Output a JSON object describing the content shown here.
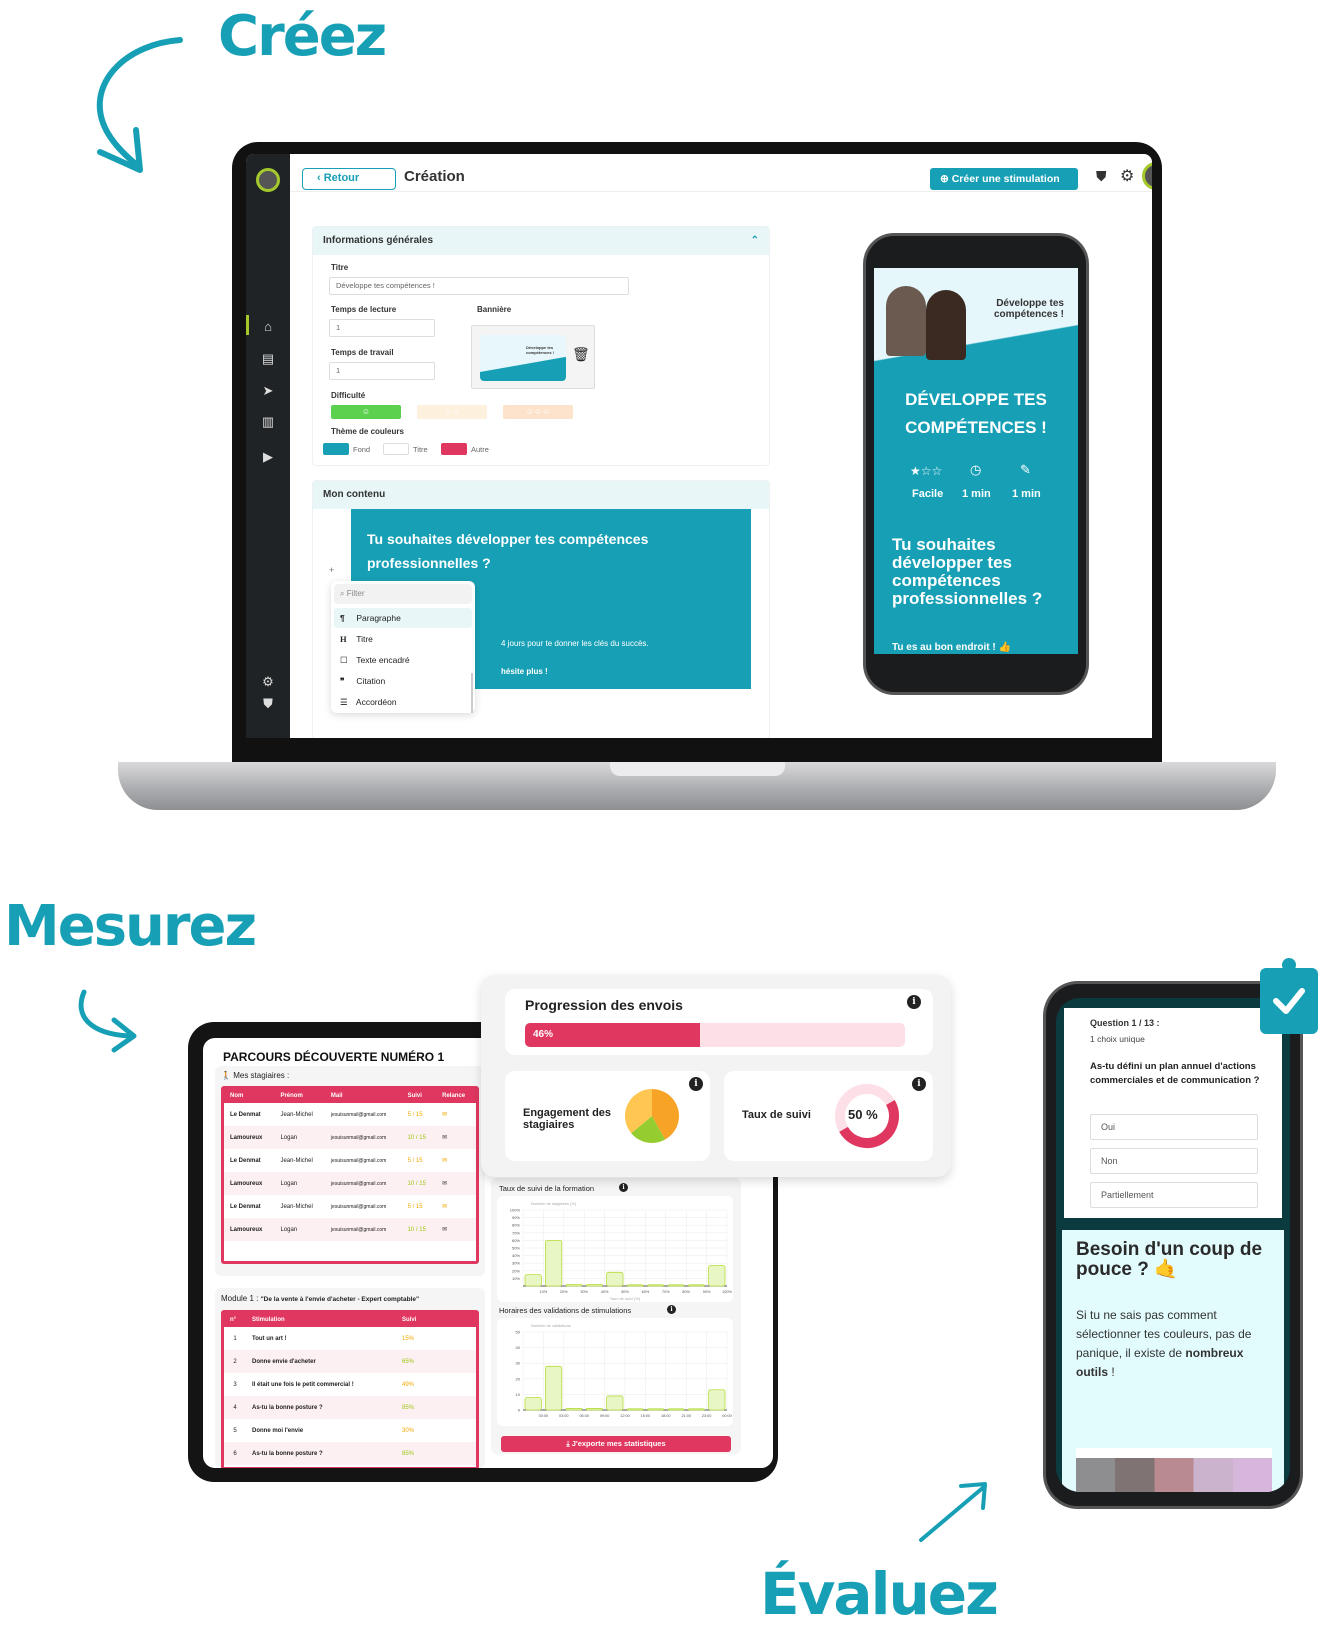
{
  "headings": {
    "create": "Créez",
    "measure": "Mesurez",
    "evaluate": "Évaluez"
  },
  "colors": {
    "teal": "#17a0b5",
    "pink": "#df375f",
    "green": "#5bd14f",
    "lime": "#9ac70f",
    "orange": "#f2a900"
  },
  "laptop": {
    "topbar": {
      "back_label": "Retour",
      "title": "Création",
      "create_button": "Créer une stimulation"
    },
    "sidebar": {
      "icons": [
        "home-icon",
        "book-icon",
        "send-icon",
        "chart-icon",
        "video-icon",
        "gear-icon",
        "shield-icon"
      ]
    },
    "general_info": {
      "header": "Informations générales",
      "title_label": "Titre",
      "title_value": "Développe tes compétences !",
      "reading_time_label": "Temps de lecture",
      "reading_time_value": "1",
      "work_time_label": "Temps de travail",
      "work_time_value": "1",
      "banner_label": "Bannière",
      "banner_text": "Développe tes compétences !",
      "difficulty_label": "Difficulté",
      "theme_label": "Thème de couleurs",
      "theme": [
        {
          "label": "Fond",
          "color": "#17a0b5"
        },
        {
          "label": "Titre",
          "color": "#ffffff"
        },
        {
          "label": "Autre",
          "color": "#df375f"
        }
      ]
    },
    "content": {
      "header": "Mon contenu",
      "heading": "Tu souhaites développer tes compétences professionnelles ?",
      "body_line": "4 jours pour te donner les clés du succès.",
      "body_cta": "hésite plus !",
      "plus": "+",
      "menu": {
        "filter_placeholder": "Filter",
        "items": [
          {
            "icon": "¶",
            "label": "Paragraphe"
          },
          {
            "icon": "H",
            "label": "Titre"
          },
          {
            "icon": "☐",
            "label": "Texte encadré"
          },
          {
            "icon": "❞",
            "label": "Citation"
          },
          {
            "icon": "☰",
            "label": "Accordéon"
          }
        ]
      }
    },
    "preview": {
      "banner_text": "Développe tes compétences !",
      "title": "DÉVELOPPE TES COMPÉTENCES !",
      "difficulty": "Facile",
      "reading_time": "1 min",
      "work_time": "1 min",
      "heading": "Tu souhaites développer tes compétences professionnelles ?",
      "subtext": "Tu es au bon endroit ! 👍"
    }
  },
  "tablet": {
    "title": "PARCOURS DÉCOUVERTE NUMÉRO 1",
    "trainees_label": "Mes stagiaires :",
    "trainees_columns": [
      "Nom",
      "Prénom",
      "Mail",
      "Suivi",
      "Relance"
    ],
    "trainees": [
      {
        "nom": "Le Denmat",
        "prenom": "Jean-Michel",
        "mail": "jesuisunmail@gmail.com",
        "suivi": "5 / 15",
        "level": "low"
      },
      {
        "nom": "Lamoureux",
        "prenom": "Logan",
        "mail": "jesuisunmail@gmail.com",
        "suivi": "10 / 15",
        "level": "high"
      },
      {
        "nom": "Le Denmat",
        "prenom": "Jean-Michel",
        "mail": "jesuisunmail@gmail.com",
        "suivi": "5 / 15",
        "level": "low"
      },
      {
        "nom": "Lamoureux",
        "prenom": "Logan",
        "mail": "jesuisunmail@gmail.com",
        "suivi": "10 / 15",
        "level": "high"
      },
      {
        "nom": "Le Denmat",
        "prenom": "Jean-Michel",
        "mail": "jesuisunmail@gmail.com",
        "suivi": "5 / 15",
        "level": "low"
      },
      {
        "nom": "Lamoureux",
        "prenom": "Logan",
        "mail": "jesuisunmail@gmail.com",
        "suivi": "10 / 15",
        "level": "high"
      }
    ],
    "module_label": "Module 1 :",
    "module_name": "\"De la vente à l'envie d'acheter - Expert comptable\"",
    "stim_columns": [
      "n°",
      "Stimulation",
      "Suivi"
    ],
    "stimulations": [
      {
        "n": "1",
        "name": "Tout un art !",
        "suivi": "15%",
        "level": "low"
      },
      {
        "n": "2",
        "name": "Donne envie d'acheter",
        "suivi": "65%",
        "level": "high"
      },
      {
        "n": "3",
        "name": "Il était une fois le petit commercial !",
        "suivi": "49%",
        "level": "low"
      },
      {
        "n": "4",
        "name": "As-tu la bonne posture ?",
        "suivi": "85%",
        "level": "high"
      },
      {
        "n": "5",
        "name": "Donne moi l'envie",
        "suivi": "30%",
        "level": "low"
      },
      {
        "n": "6",
        "name": "As-tu la bonne posture ?",
        "suivi": "85%",
        "level": "high"
      }
    ]
  },
  "stats": {
    "progress_title": "Progression des envois",
    "progress_value": 46,
    "progress_label": "46%",
    "engagement_label": "Engagement des stagiaires",
    "engagement_slices": [
      {
        "value": 42,
        "color": "#f7a326"
      },
      {
        "value": 22,
        "color": "#95cc2f"
      },
      {
        "value": 36,
        "color": "#ffc652"
      }
    ],
    "followup_label": "Taux de suivi",
    "followup_value": 50,
    "followup_text": "50 %",
    "export_button": "J'exporte mes statistiques"
  },
  "chart_data": [
    {
      "type": "bar",
      "title": "Taux de suivi de la formation",
      "ylabel": "Nombre de stagiaires (%)",
      "xlabel": "Taux de suivi (%)",
      "categories": [
        "10%",
        "20%",
        "30%",
        "40%",
        "50%",
        "60%",
        "70%",
        "80%",
        "90%",
        "100%"
      ],
      "values": [
        15,
        60,
        2,
        2,
        18,
        0,
        0,
        0,
        0,
        27
      ],
      "yticks": [
        "10%",
        "20%",
        "30%",
        "40%",
        "50%",
        "60%",
        "70%",
        "80%",
        "90%",
        "100%"
      ],
      "ylim": [
        0,
        100
      ],
      "grid": true
    },
    {
      "type": "bar",
      "title": "Horaires des validations de stimulations",
      "ylabel": "Nombre de validations",
      "xlabel": "",
      "categories": [
        "00:00",
        "03:00",
        "06:00",
        "09:00",
        "12:00",
        "15:00",
        "18:00",
        "21:00",
        "23:00",
        "00:00"
      ],
      "values": [
        8,
        28,
        1,
        1,
        9,
        0,
        0,
        0,
        0,
        13
      ],
      "yticks": [
        "0",
        "10",
        "20",
        "30",
        "40",
        "50"
      ],
      "ylim": [
        0,
        50
      ],
      "grid": true
    }
  ],
  "quiz_phone": {
    "question_number": "Question 1 / 13 :",
    "question_type": "1 choix unique",
    "question": "As-tu défini un plan annuel d'actions commerciales et de communication ?",
    "options": [
      "Oui",
      "Non",
      "Partiellement"
    ],
    "help_title": "Besoin d'un coup de pouce ? 🤙",
    "help_text": "Si tu ne sais pas comment sélectionner tes couleurs, pas de panique, il existe de",
    "help_bold": "nombreux outils",
    "help_end": " !"
  }
}
